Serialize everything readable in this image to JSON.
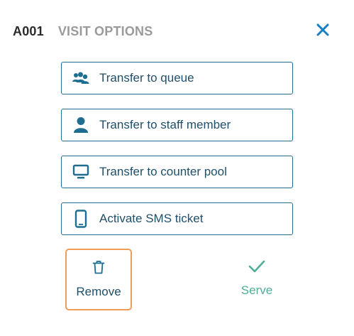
{
  "header": {
    "ticket_id": "A001",
    "title": "VISIT OPTIONS",
    "close_icon": "close-icon"
  },
  "options": [
    {
      "label": "Transfer to queue",
      "icon": "users-group-icon"
    },
    {
      "label": "Transfer to staff member",
      "icon": "user-icon"
    },
    {
      "label": "Transfer to counter pool",
      "icon": "monitor-icon"
    },
    {
      "label": "Activate SMS ticket",
      "icon": "mobile-phone-icon"
    }
  ],
  "actions": {
    "remove": {
      "label": "Remove",
      "icon": "trash-icon"
    },
    "serve": {
      "label": "Serve",
      "icon": "checkmark-icon"
    }
  },
  "colors": {
    "primary": "#1f6e92",
    "text": "#1f4f6a",
    "close": "#1a7fc0",
    "title_muted": "#9a9a9a",
    "serve": "#4fae98",
    "focus_outline": "#ef9d55"
  }
}
